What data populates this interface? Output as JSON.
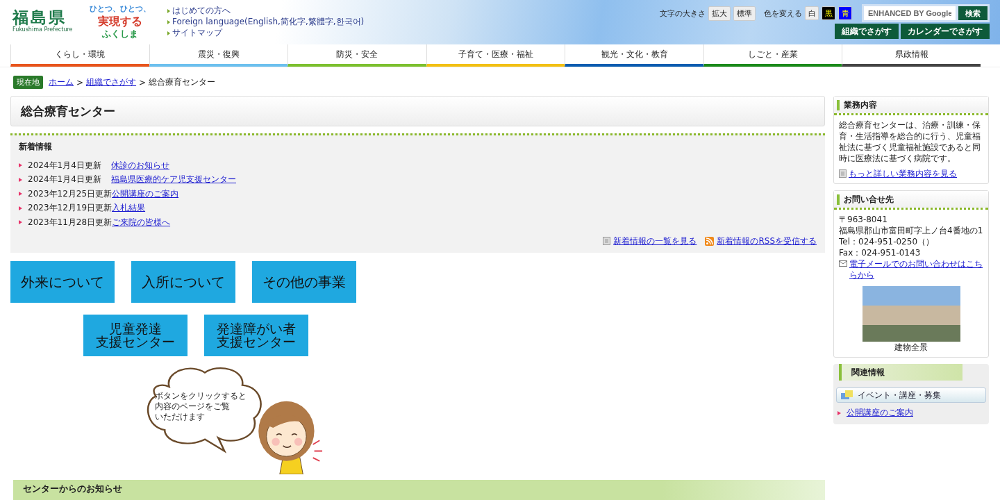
{
  "header": {
    "logo": {
      "name": "福島県",
      "subtitle": "Fukushima Prefecture",
      "slogan": [
        "ひとつ、ひとつ、",
        "実現する",
        "ふくしま"
      ]
    },
    "links": [
      "はじめての方へ",
      "Foreign language(English,简化字,繁體字,한국어)",
      "サイトマップ"
    ],
    "text_size": {
      "label": "文字の大きさ",
      "buttons": [
        "拡大",
        "標準"
      ]
    },
    "color_change": {
      "label": "色を変える",
      "options": [
        {
          "label": "白",
          "color": "#eeeeee"
        },
        {
          "label": "黒",
          "color": "#000000"
        },
        {
          "label": "青",
          "color": "#0000ff"
        }
      ]
    },
    "search": {
      "placeholder": "ENHANCED BY Google",
      "button": "検索"
    },
    "search_buttons": [
      "組織でさがす",
      "カレンダーでさがす"
    ]
  },
  "nav": [
    {
      "label": "くらし・環境",
      "color": "#e8541c"
    },
    {
      "label": "震災・復興",
      "color": "#6cc0ee"
    },
    {
      "label": "防災・安全",
      "color": "#7cc02e"
    },
    {
      "label": "子育て・医療・福祉",
      "color": "#f2c012"
    },
    {
      "label": "観光・文化・教育",
      "color": "#0a5cb0"
    },
    {
      "label": "しごと・産業",
      "color": "#1a8a1a"
    },
    {
      "label": "県政情報",
      "color": "#444444"
    }
  ],
  "breadcrumb": {
    "label": "現在地",
    "items": [
      {
        "text": "ホーム",
        "kind": "link"
      },
      {
        "text": ">",
        "kind": "separator"
      },
      {
        "text": "組織でさがす",
        "kind": "link"
      },
      {
        "text": ">",
        "kind": "separator"
      },
      {
        "text": "総合療育センター",
        "kind": "current"
      }
    ]
  },
  "page_title": "総合療育センター",
  "news": {
    "heading": "新着情報",
    "items": [
      {
        "date": "2024年1月4日更新",
        "title": "休診のお知らせ"
      },
      {
        "date": "2024年1月4日更新",
        "title": "福島県医療的ケア児支援センター"
      },
      {
        "date": "2023年12月25日更新",
        "title": "公開講座のご案内"
      },
      {
        "date": "2023年12月19日更新",
        "title": "入札結果"
      },
      {
        "date": "2023年11月28日更新",
        "title": "ご来院の皆様へ"
      }
    ],
    "footer_links": [
      {
        "kind": "list",
        "text": "新着情報の一覧を見る"
      },
      {
        "kind": "rss",
        "text": "新着情報のRSSを受信する"
      }
    ]
  },
  "tiles": [
    [
      {
        "lines": [
          "外来について"
        ]
      },
      {
        "lines": [
          "入所について"
        ]
      },
      {
        "lines": [
          "その他の事業"
        ]
      }
    ],
    [
      {
        "lines": [
          "児童発達",
          "支援センター"
        ]
      },
      {
        "lines": [
          "発達障がい者",
          "支援センター"
        ]
      }
    ]
  ],
  "illustration": {
    "speech": [
      "ボタンをクリックすると",
      "内容のページをご覧",
      "いただけます"
    ]
  },
  "section_heading": "センターからのお知らせ",
  "sidebar": {
    "business": {
      "heading": "業務内容",
      "text": "総合療育センターは、治療・訓練・保育・生活指導を総合的に行う、児童福祉法に基づく児童福祉施設であると同時に医療法に基づく病院です。",
      "link": "もっと詳しい業務内容を見る"
    },
    "contact": {
      "heading": "お問い合せ先",
      "lines": [
        "〒963-8041",
        "福島県郡山市富田町字上ノ台4番地の1",
        "Tel：024-951-0250（）",
        "Fax：024-951-0143"
      ],
      "email_link": "電子メールでのお問い合わせはこちらから",
      "photo_caption": "建物全景"
    },
    "related": {
      "heading": "関連情報",
      "category": "イベント・講座・募集",
      "links": [
        "公開講座のご案内"
      ]
    }
  }
}
